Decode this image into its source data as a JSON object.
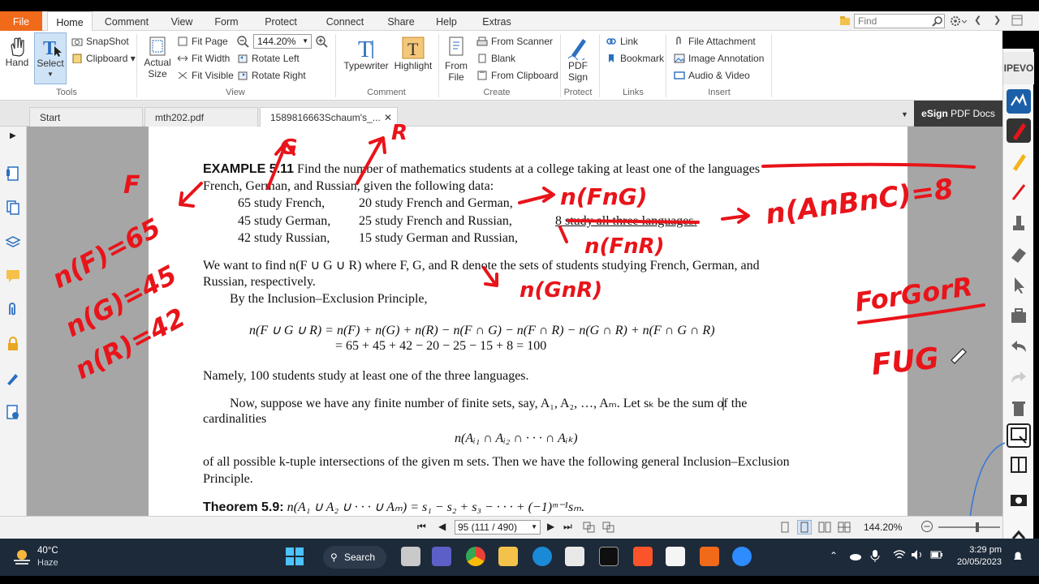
{
  "menu": {
    "tabs": [
      "File",
      "Home",
      "Comment",
      "View",
      "Form",
      "Protect",
      "Connect",
      "Share",
      "Help",
      "Extras"
    ],
    "find_placeholder": "Find"
  },
  "ribbon": {
    "hand": "Hand",
    "select": "Select",
    "snapshot": "SnapShot",
    "clipboard": "Clipboard",
    "tools_group": "Tools",
    "actual_size": "Actual Size",
    "fit_page": "Fit Page",
    "fit_width": "Fit Width",
    "fit_visible": "Fit Visible",
    "zoom_value": "144.20%",
    "rotate_left": "Rotate Left",
    "rotate_right": "Rotate Right",
    "view_group": "View",
    "typewriter": "Typewriter",
    "highlight": "Highlight",
    "comment_group": "Comment",
    "from_file": "From File",
    "from_scanner": "From Scanner",
    "blank": "Blank",
    "from_clipboard": "From Clipboard",
    "create_group": "Create",
    "pdf_sign": "PDF Sign",
    "protect_group": "Protect",
    "link": "Link",
    "bookmark": "Bookmark",
    "links_group": "Links",
    "file_attachment": "File Attachment",
    "image_annotation": "Image Annotation",
    "audio_video": "Audio & Video",
    "insert_group": "Insert"
  },
  "doc_tabs": [
    "Start",
    "mth202.pdf",
    "1589816663Schaum's_..."
  ],
  "esign": {
    "brand": "eSign",
    "label": "PDF Docs"
  },
  "page": {
    "example_label": "EXAMPLE 5.11",
    "line1": "Find the number of mathematics students at a college taking at least one of the languages",
    "line2": "French, German, and Russian, given the following data:",
    "d1a": "65 study French,",
    "d1b": "20 study French and German,",
    "d2a": "45 study German,",
    "d2b": "25 study French and Russian,",
    "d2c": "8 study all three languages.",
    "d3a": "42 study Russian,",
    "d3b": "15 study German and Russian,",
    "p1": "We want to find n(F ∪ G ∪ R) where F, G, and R denote the sets of students studying French, German, and",
    "p1b": "Russian, respectively.",
    "p2": "By the Inclusion–Exclusion Principle,",
    "eq1": "n(F ∪ G ∪ R) = n(F) + n(G) + n(R) − n(F ∩ G) − n(F ∩ R) − n(G ∩ R) + n(F ∩ G ∩ R)",
    "eq2": "= 65 + 45 + 42 − 20 − 25 − 15 + 8 = 100",
    "p3": "Namely, 100 students study at least one of the three languages.",
    "p4": "Now, suppose we have any finite number of finite sets, say, A₁, A₂, …, Aₘ.  Let sₖ be the sum of the",
    "p4b": "cardinalities",
    "eq3": "n(Aᵢ₁ ∩ Aᵢ₂ ∩ · · · ∩ Aᵢₖ)",
    "p5": "of all possible k-tuple intersections of the given m sets.  Then we have the following general Inclusion–Exclusion",
    "p5b": "Principle.",
    "theorem_label": "Theorem 5.9:",
    "theorem": "n(A₁ ∪ A₂ ∪ · · · ∪ Aₘ) = s₁ − s₂ + s₃ − · · · + (−1)ᵐ⁻¹sₘ."
  },
  "annotations": {
    "G": "G",
    "R": "R",
    "F": "F",
    "nF": "n(F)=65",
    "nG": "n(G)=45",
    "nR": "n(R)=42",
    "nFG": "n(FnG)",
    "nFR": "n(FnR)",
    "nGR": "n(GnR)",
    "nFGR": "n(AnBnC)=8",
    "fgr": "ForGorR",
    "fug": "FUG"
  },
  "status": {
    "page_field": "95 (111 / 490)",
    "zoom": "144.20%"
  },
  "taskbar": {
    "weather_temp": "40°C",
    "weather_desc": "Haze",
    "search": "Search",
    "time": "3:29 pm",
    "date": "20/05/2023"
  },
  "colors": {
    "accent": "#f06a1a",
    "ink": "#e8141a",
    "esign_bg": "#3a3a3a"
  }
}
